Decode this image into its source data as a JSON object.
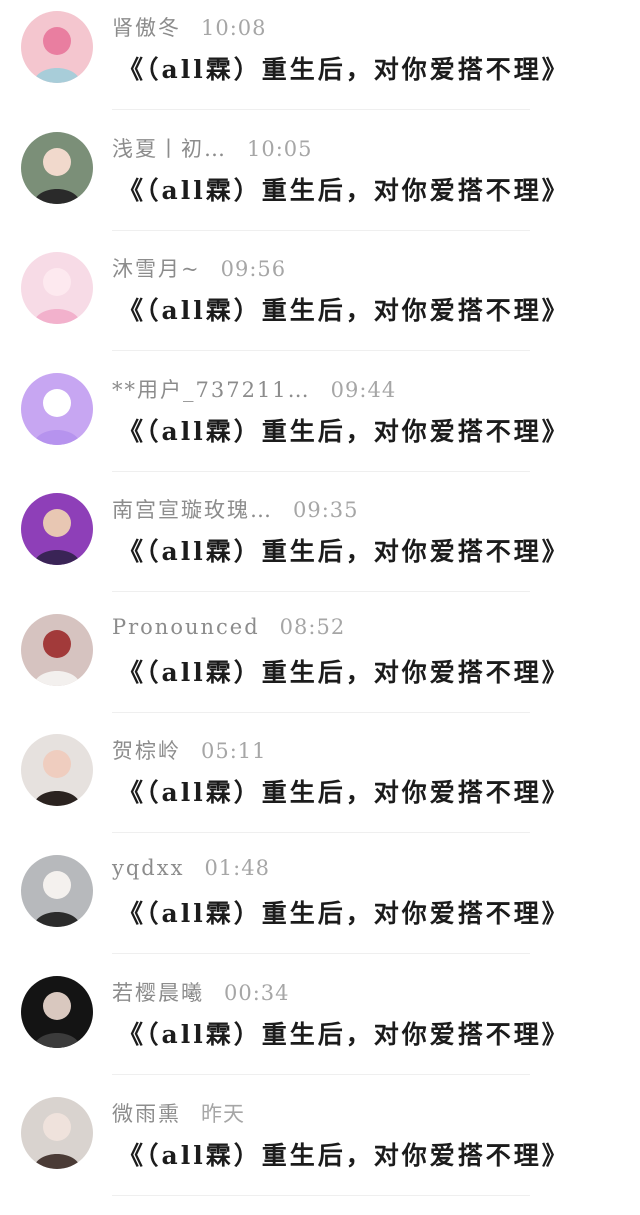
{
  "messages": [
    {
      "name": "肾傲冬",
      "time": "10:08",
      "text": "《（all霖）重生后，对你爱搭不理》",
      "avatar": "flower-avatar",
      "colors": [
        "#f4c6cf",
        "#a8cdd9",
        "#e97ea0"
      ]
    },
    {
      "name": "浅夏丨初…",
      "time": "10:05",
      "text": "《（all霖）重生后，对你爱搭不理》",
      "avatar": "girl-avatar",
      "colors": [
        "#7b8f78",
        "#2a2a2a",
        "#f1d9cc"
      ]
    },
    {
      "name": "沐雪月~",
      "time": "09:56",
      "text": "《（all霖）重生后，对你爱搭不理》",
      "avatar": "anime-pink-avatar",
      "colors": [
        "#f7dbe6",
        "#f2b1cc",
        "#fde9ef"
      ]
    },
    {
      "name": "**用户_737211…",
      "time": "09:44",
      "text": "《（all霖）重生后，对你爱搭不理》",
      "avatar": "chat-bubble-avatar",
      "colors": [
        "#c7a6f2",
        "#b693ee",
        "#ffffff"
      ]
    },
    {
      "name": "南宫宣璇玫瑰…",
      "time": "09:35",
      "text": "《（all霖）重生后，对你爱搭不理》",
      "avatar": "man-suit-avatar",
      "colors": [
        "#8e3fb8",
        "#3a2456",
        "#e8c7b3"
      ]
    },
    {
      "name": "Pronounced",
      "time": "08:52",
      "text": "《（all霖）重生后，对你爱搭不理》",
      "avatar": "girl-hood-avatar",
      "colors": [
        "#d6c3c0",
        "#f3f0ee",
        "#a23a3a"
      ]
    },
    {
      "name": "贺棕岭",
      "time": "05:11",
      "text": "《（all霖）重生后，对你爱搭不理》",
      "avatar": "boy-portrait-avatar",
      "colors": [
        "#e6e1de",
        "#2b2320",
        "#efcdbf"
      ]
    },
    {
      "name": "yqdxx",
      "time": "01:48",
      "text": "《（all霖）重生后，对你爱搭不理》",
      "avatar": "man-white-avatar",
      "colors": [
        "#b7b9bc",
        "#2b2b2b",
        "#f4f1ee"
      ]
    },
    {
      "name": "若樱晨曦",
      "time": "00:34",
      "text": "《（all霖）重生后，对你爱搭不理》",
      "avatar": "boy-dark-avatar",
      "colors": [
        "#141414",
        "#3b3b3b",
        "#d9c8bf"
      ]
    },
    {
      "name": "微雨熏",
      "time": "昨天",
      "text": "《（all霖）重生后，对你爱搭不理》",
      "avatar": "girl-soft-avatar",
      "colors": [
        "#d9d3cf",
        "#4a3b36",
        "#efe2dc"
      ]
    }
  ]
}
